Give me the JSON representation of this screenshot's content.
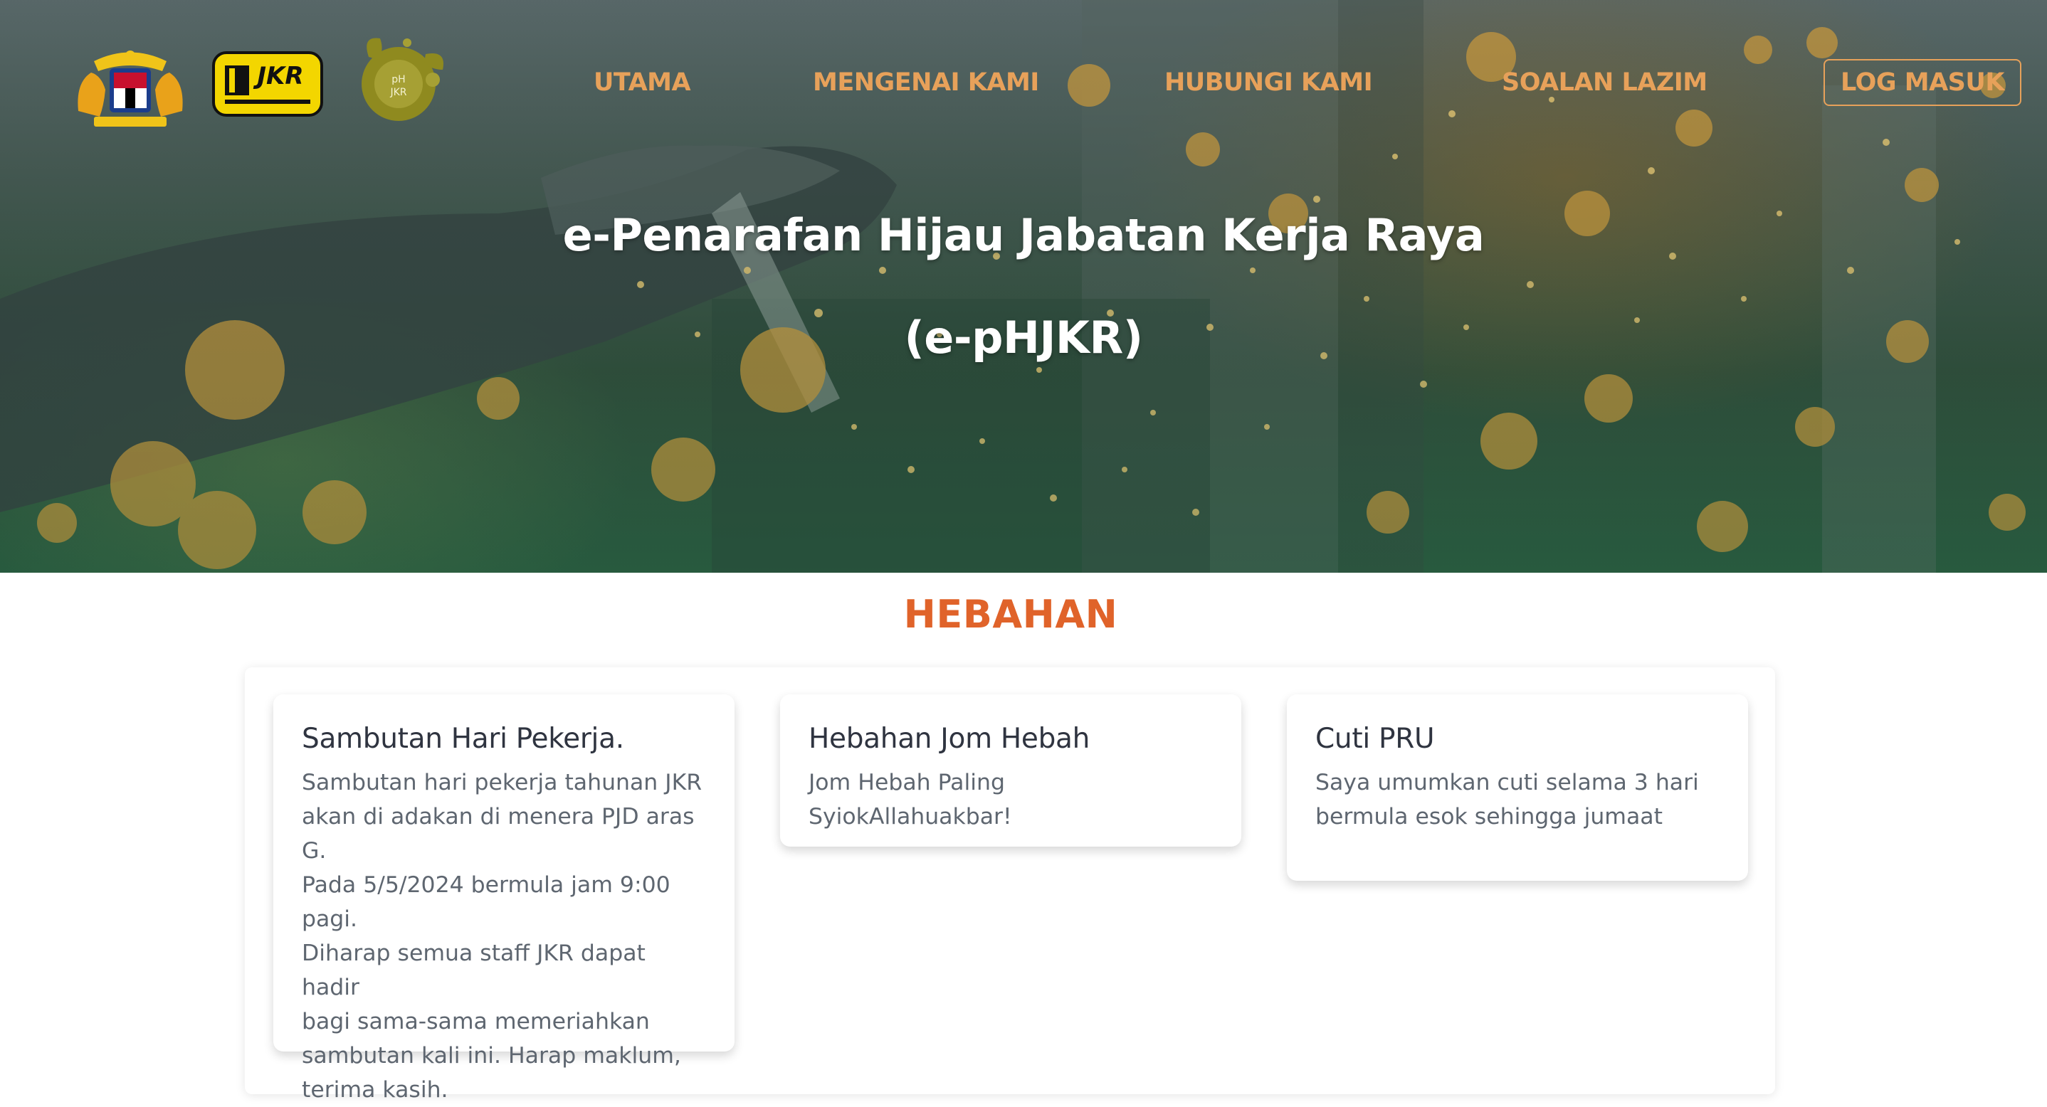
{
  "header": {
    "logos": [
      {
        "name": "malaysia-coat-of-arms",
        "icon": "coat-of-arms-logo"
      },
      {
        "name": "jkr",
        "text": "JKR",
        "icon": "jkr-logo"
      },
      {
        "name": "phjkr",
        "text": "pH\nJKR",
        "icon": "phjkr-logo"
      }
    ],
    "nav": {
      "utama": "UTAMA",
      "mengenai_kami": "MENGENAI KAMI",
      "hubungi_kami": "HUBUNGI KAMI",
      "soalan_lazim": "SOALAN LAZIM"
    },
    "login_label": "LOG MASUK"
  },
  "hero": {
    "title_line1": "e-Penarafan Hijau Jabatan Kerja Raya",
    "title_line2": "(e-pHJKR)"
  },
  "announcements": {
    "heading": "HEBAHAN",
    "items": [
      {
        "title": "Sambutan Hari Pekerja.",
        "body_lines": [
          "Sambutan hari pekerja tahunan JKR",
          "akan di adakan di menera PJD aras G.",
          "Pada 5/5/2024 bermula jam 9:00 pagi.",
          "Diharap semua staff JKR dapat hadir",
          "bagi sama-sama memeriahkan",
          "sambutan kali ini. Harap maklum,",
          "terima kasih."
        ]
      },
      {
        "title": "Hebahan Jom Hebah",
        "body_lines": [
          "Jom Hebah Paling SyiokAllahuakbar!"
        ]
      },
      {
        "title": "Cuti PRU",
        "body_lines": [
          "Saya umumkan cuti selama 3 hari",
          "bermula esok sehingga jumaat"
        ]
      }
    ]
  },
  "colors": {
    "nav_text": "#e7a15a",
    "heading_accent": "#e0632a",
    "card_title": "#2f3440",
    "card_body": "#5e6670",
    "jkr_yellow": "#f3d600"
  }
}
